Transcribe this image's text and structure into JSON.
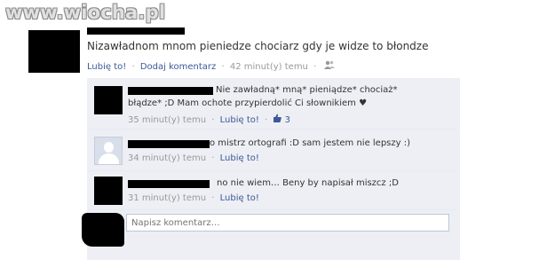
{
  "watermark": "www.wiocha.pl",
  "post": {
    "text": "Nizawładnom mnom pieniedze chociarz gdy je widze to błondze",
    "like_label": "Lubię to!",
    "comment_label": "Dodaj komentarz",
    "time": "42 minut(y) temu",
    "separator": "·"
  },
  "comments": [
    {
      "text_line1": "Nie zawładną* mną* pieniądze* chociaż*",
      "text_line2": "błądze* ;D Mam ochote przypierdolić Ci słownikiem ♥",
      "time": "35 minut(y) temu",
      "like_label": "Lubię to!",
      "likes_count": "3",
      "like_icon": "thumbs-up-icon"
    },
    {
      "text_line1": "o mistrz ortografi :D sam jestem nie lepszy :)",
      "time": "34 minut(y) temu",
      "like_label": "Lubię to!"
    },
    {
      "text_line1": "no nie wiem… Beny by napisał miszcz ;D",
      "time": "31 minut(y) temu",
      "like_label": "Lubię to!"
    }
  ],
  "comment_box": {
    "placeholder": "Napisz komentarz…"
  },
  "colors": {
    "link": "#3b5998",
    "comment_bg": "#edeff4",
    "muted": "#999999"
  }
}
